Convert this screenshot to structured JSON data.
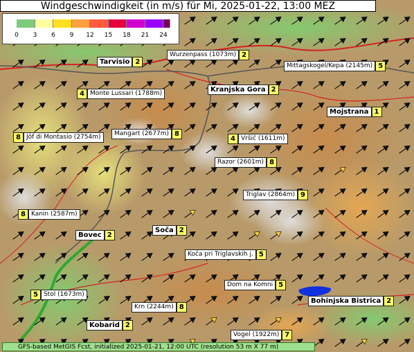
{
  "title": "Windgeschwindigkeit (in m/s) für Mi, 2025-01-22, 13:00 MEZ",
  "legend": {
    "ticks": [
      "0",
      "3",
      "6",
      "9",
      "12",
      "15",
      "18",
      "21",
      "24"
    ],
    "colors": [
      "#7ecb7e",
      "#ffffa0",
      "#ffe020",
      "#ffa040",
      "#ff5a3c",
      "#e6003c",
      "#d000d0",
      "#9a00ff",
      "#7a0060"
    ]
  },
  "footer": "GFS-based MetGIS Fcst, initialized 2025-01-21, 12:00 UTC  (resolution 53 m X 77 m)",
  "places": [
    {
      "id": "tarvisio",
      "name": "Tarvisio",
      "value": "2",
      "kind": "town",
      "lead": false
    },
    {
      "id": "wurzenpass",
      "name": "Wurzenpass (1073m)",
      "value": "2",
      "kind": "peak",
      "lead": false
    },
    {
      "id": "mittagskogel",
      "name": "Mittagskogel/Kepa (2145m)",
      "value": "5",
      "kind": "peak",
      "lead": false
    },
    {
      "id": "monte-lussari",
      "name": "Monte Lussari (1788m)",
      "value": "4",
      "kind": "peak",
      "lead": true
    },
    {
      "id": "kranjska-gora",
      "name": "Kranjska Gora",
      "value": "2",
      "kind": "town",
      "lead": false
    },
    {
      "id": "mojstrana",
      "name": "Mojstrana",
      "value": "1",
      "kind": "town",
      "lead": false
    },
    {
      "id": "jof-di-montasio",
      "name": "Jôf di Montasio (2754m)",
      "value": "8",
      "kind": "peak",
      "lead": true
    },
    {
      "id": "mangart",
      "name": "Mangart (2677m)",
      "value": "8",
      "kind": "peak",
      "lead": false
    },
    {
      "id": "vrsic",
      "name": "Vršič (1611m)",
      "value": "4",
      "kind": "peak",
      "lead": true
    },
    {
      "id": "razor",
      "name": "Razor (2601m)",
      "value": "8",
      "kind": "peak",
      "lead": false
    },
    {
      "id": "triglav",
      "name": "Triglav (2864m)",
      "value": "9",
      "kind": "peak",
      "lead": false
    },
    {
      "id": "kanin",
      "name": "Kanin (2587m)",
      "value": "8",
      "kind": "peak",
      "lead": true
    },
    {
      "id": "bovec",
      "name": "Bovec",
      "value": "2",
      "kind": "town",
      "lead": false
    },
    {
      "id": "soca",
      "name": "Soča",
      "value": "2",
      "kind": "town",
      "lead": false
    },
    {
      "id": "koca-pri-triglavskih",
      "name": "Koča pri Triglavskih j.",
      "value": "5",
      "kind": "peak",
      "lead": false
    },
    {
      "id": "dom-na-komni",
      "name": "Dom na Komni",
      "value": "5",
      "kind": "peak",
      "lead": false
    },
    {
      "id": "stol",
      "name": "Stol (1673m)",
      "value": "5",
      "kind": "peak",
      "lead": true
    },
    {
      "id": "bohinjska-bistrica",
      "name": "Bohinjska Bistrica",
      "value": "2",
      "kind": "town",
      "lead": false
    },
    {
      "id": "krn",
      "name": "Krn (2244m)",
      "value": "8",
      "kind": "peak",
      "lead": false
    },
    {
      "id": "kobarid",
      "name": "Kobarid",
      "value": "2",
      "kind": "town",
      "lead": false
    },
    {
      "id": "vogel",
      "name": "Vogel (1922m)",
      "value": "7",
      "kind": "peak",
      "lead": false
    }
  ]
}
